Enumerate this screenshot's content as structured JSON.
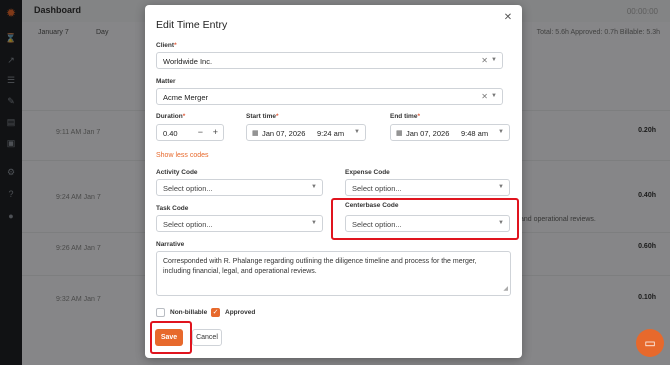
{
  "background": {
    "title": "Dashboard",
    "date": "January 7",
    "view": "Day",
    "totals": "Total: 5.6h  Approved: 0.7h  Billable: 5.3h",
    "timer": "00:00:00",
    "rows": [
      {
        "time": "9:11 AM Jan 7",
        "hours": "0.20h"
      },
      {
        "time": "9:24 AM Jan 7",
        "hours": "0.40h",
        "text": "and operational reviews."
      },
      {
        "time": "9:26 AM Jan 7",
        "hours": "0.60h"
      },
      {
        "time": "9:32 AM Jan 7",
        "hours": "0.10h"
      }
    ]
  },
  "modal": {
    "title": "Edit Time Entry",
    "client": {
      "label": "Client",
      "value": "Worldwide Inc."
    },
    "matter": {
      "label": "Matter",
      "value": "Acme Merger"
    },
    "duration": {
      "label": "Duration",
      "value": "0.40"
    },
    "start": {
      "label": "Start time",
      "date": "Jan 07, 2026",
      "time": "9:24 am"
    },
    "end": {
      "label": "End time",
      "date": "Jan 07, 2026",
      "time": "9:48 am"
    },
    "show_less": "Show less codes",
    "activity": {
      "label": "Activity Code",
      "placeholder": "Select option..."
    },
    "expense": {
      "label": "Expense Code",
      "placeholder": "Select option..."
    },
    "task": {
      "label": "Task Code",
      "placeholder": "Select option..."
    },
    "centerbase": {
      "label": "Centerbase Code",
      "placeholder": "Select option..."
    },
    "narrative": {
      "label": "Narrative",
      "value": "Corresponded with R. Phalange regarding outlining the diligence timeline and process for the merger, including financial, legal, and operational reviews."
    },
    "non_billable": {
      "label": "Non-billable",
      "checked": false
    },
    "approved": {
      "label": "Approved",
      "checked": true
    },
    "save": "Save",
    "cancel": "Cancel"
  },
  "colors": {
    "accent": "#e7692c",
    "highlight": "#e0141e"
  }
}
